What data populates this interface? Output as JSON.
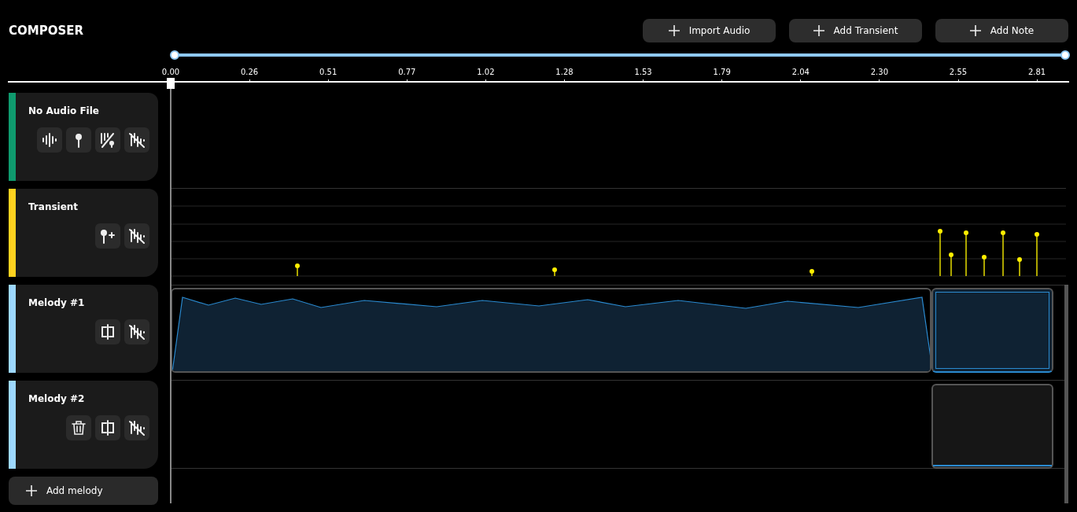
{
  "title": "COMPOSER",
  "actions": [
    {
      "label": "Import Audio"
    },
    {
      "label": "Add Transient"
    },
    {
      "label": "Add Note"
    }
  ],
  "range_slider": {
    "level": 1
  },
  "ruler": {
    "ticks": [
      "0.00",
      "0.26",
      "0.51",
      "0.77",
      "1.02",
      "1.28",
      "1.53",
      "1.79",
      "2.04",
      "2.30",
      "2.55",
      "2.81"
    ]
  },
  "tracks": [
    {
      "name": "No Audio File",
      "kind": "audio",
      "color": "#0f9a6e",
      "controls": [
        {
          "kind": "waveform"
        },
        {
          "kind": "pin"
        },
        {
          "kind": "split-pin"
        },
        {
          "kind": "mute"
        }
      ]
    },
    {
      "name": "Transient",
      "kind": "transient",
      "color": "#ffd21f",
      "controls": [
        {
          "kind": "pin-add"
        },
        {
          "kind": "mute"
        }
      ]
    },
    {
      "name": "Melody #1",
      "kind": "melody",
      "color": "#9dd8ff",
      "controls": [
        {
          "kind": "split"
        },
        {
          "kind": "mute"
        }
      ]
    },
    {
      "name": "Melody #2",
      "kind": "melody-empty",
      "color": "#9dd8ff",
      "controls": [
        {
          "kind": "delete"
        },
        {
          "kind": "split"
        },
        {
          "kind": "mute"
        }
      ]
    }
  ],
  "add_melody": {
    "label": "Add melody"
  }
}
